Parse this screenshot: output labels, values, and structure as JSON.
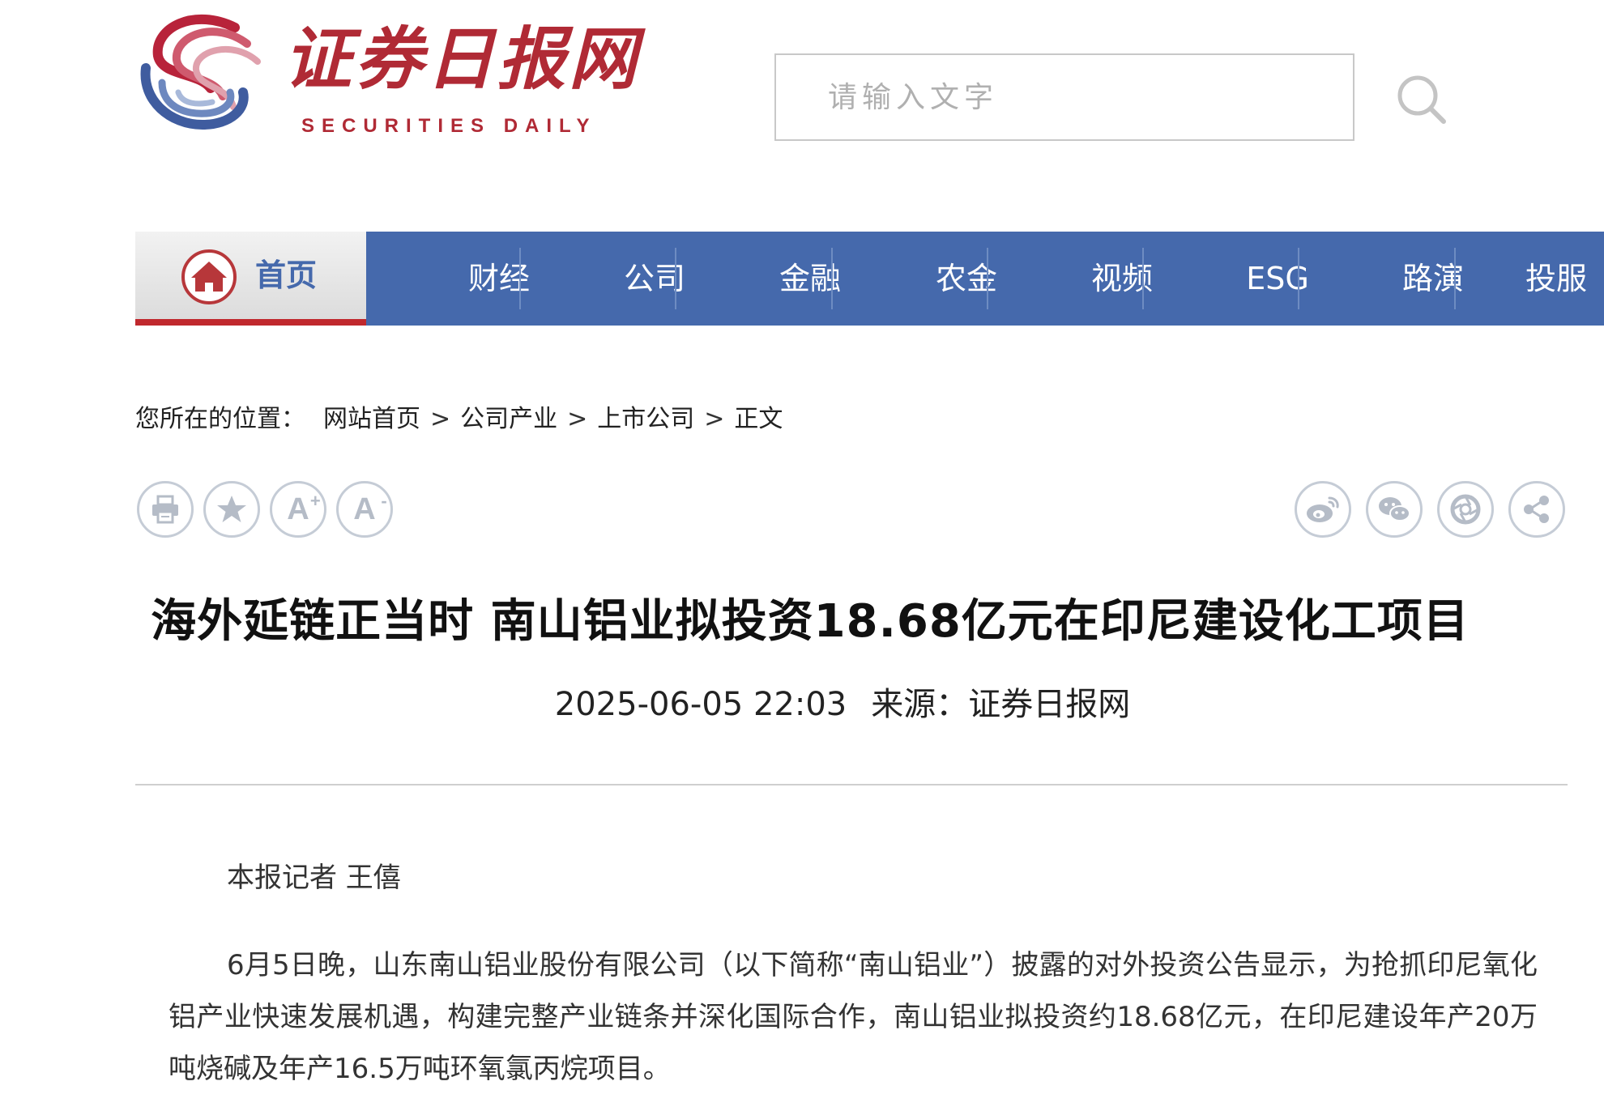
{
  "header": {
    "logo_text_cn": "证券日报网",
    "logo_text_en": "SECURITIES DAILY",
    "search_placeholder": "请输入文字",
    "brand_color": "#b02a35"
  },
  "nav": {
    "home_label": "首页",
    "items": [
      "财经",
      "公司",
      "金融",
      "农金",
      "视频",
      "ESG",
      "路演",
      "投服"
    ],
    "background_color": "#4569ac",
    "active_indicator_color": "#c0282d"
  },
  "breadcrumb": {
    "prefix": "您所在的位置：",
    "items": [
      "网站首页",
      "公司产业",
      "上市公司",
      "正文"
    ],
    "separator": ">"
  },
  "tools": {
    "left": [
      "print-icon",
      "favorite-star-icon",
      "font-increase-icon",
      "font-decrease-icon"
    ],
    "right": [
      "weibo-icon",
      "wechat-icon",
      "moments-icon",
      "share-icon"
    ],
    "font_increase_glyph": "A",
    "font_increase_sup": "+",
    "font_decrease_glyph": "A",
    "font_decrease_sup": "-"
  },
  "article": {
    "title": "海外延链正当时 南山铝业拟投资18.68亿元在印尼建设化工项目",
    "datetime": "2025-06-05 22:03",
    "source": "来源：证券日报网",
    "byline": "本报记者 王僖",
    "paragraphs": [
      "6月5日晚，山东南山铝业股份有限公司（以下简称“南山铝业”）披露的对外投资公告显示，为抢抓印尼氧化铝产业快速发展机遇，构建完整产业链条并深化国际合作，南山铝业拟投资约18.68亿元，在印尼建设年产20万吨烧碱及年产16.5万吨环氧氯丙烷项目。"
    ]
  }
}
